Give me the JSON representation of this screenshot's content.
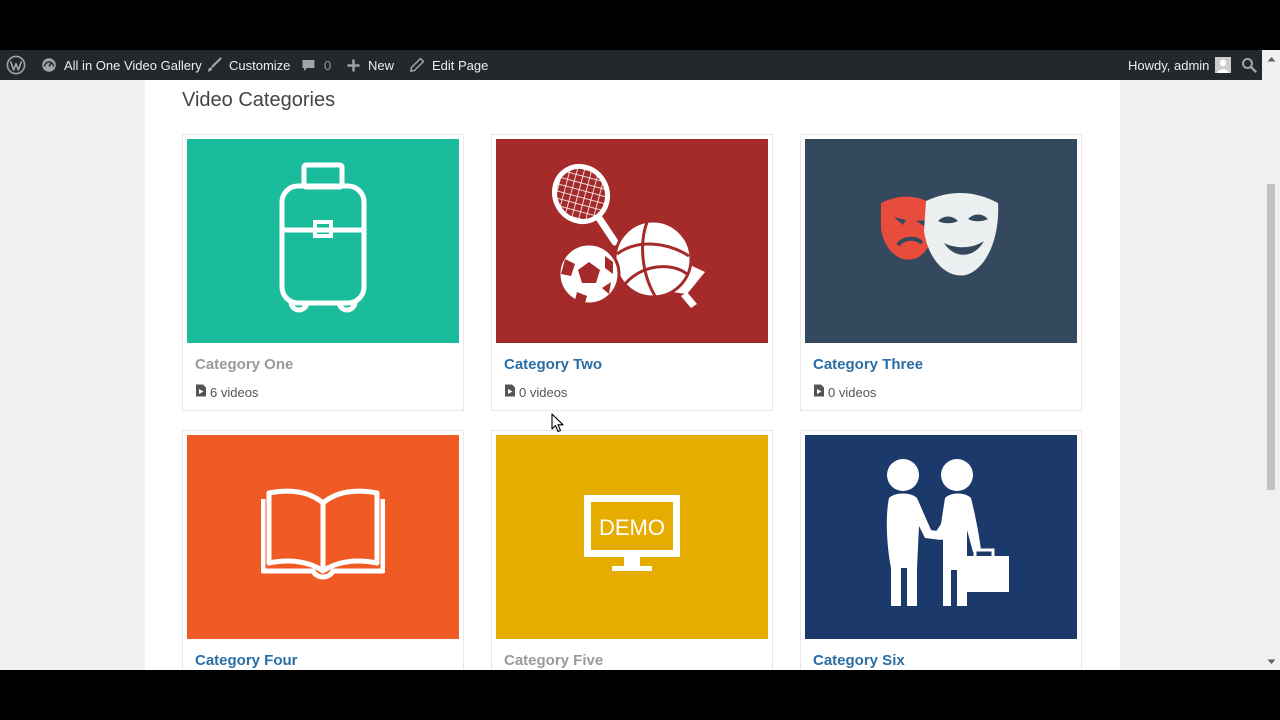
{
  "admin_bar": {
    "site_name": "All in One Video Gallery",
    "customize": "Customize",
    "comments_count": "0",
    "new_label": "New",
    "edit_page": "Edit Page",
    "howdy": "Howdy, admin",
    "icons": [
      "wordpress-logo-icon",
      "dashboard-icon",
      "brush-icon",
      "comment-icon",
      "plus-icon",
      "pencil-icon",
      "search-icon"
    ]
  },
  "page": {
    "title": "Video Categories"
  },
  "categories": [
    {
      "title": "Category One",
      "count": "6 videos",
      "color": "#1abc9c",
      "icon": "luggage-icon"
    },
    {
      "title": "Category Two",
      "count": "0 videos",
      "color": "#a52a2a",
      "icon": "sports-icon"
    },
    {
      "title": "Category Three",
      "count": "0 videos",
      "color": "#34495e",
      "icon": "theater-masks-icon"
    },
    {
      "title": "Category Four",
      "color": "#f05a24",
      "icon": "open-book-icon"
    },
    {
      "title": "Category Five",
      "color": "#e6ac00",
      "icon": "demo-monitor-icon",
      "demo_text": "DEMO"
    },
    {
      "title": "Category Six",
      "color": "#1b3a6b",
      "icon": "business-handshake-icon"
    }
  ]
}
